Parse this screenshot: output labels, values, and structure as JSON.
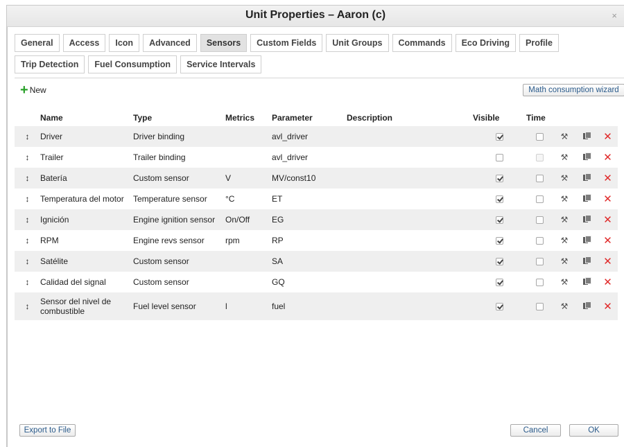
{
  "window": {
    "title": "Unit Properties – Aaron (c)",
    "close_glyph": "×"
  },
  "tabs_row1": [
    {
      "label": "General",
      "active": false
    },
    {
      "label": "Access",
      "active": false
    },
    {
      "label": "Icon",
      "active": false
    },
    {
      "label": "Advanced",
      "active": false
    },
    {
      "label": "Sensors",
      "active": true
    },
    {
      "label": "Custom Fields",
      "active": false
    },
    {
      "label": "Unit Groups",
      "active": false
    },
    {
      "label": "Commands",
      "active": false
    },
    {
      "label": "Eco Driving",
      "active": false
    },
    {
      "label": "Profile",
      "active": false
    }
  ],
  "tabs_row2": [
    {
      "label": "Trip Detection",
      "active": false
    },
    {
      "label": "Fuel Consumption",
      "active": false
    },
    {
      "label": "Service Intervals",
      "active": false
    }
  ],
  "toolbar": {
    "new_label": "New",
    "wizard_label": "Math consumption wizard"
  },
  "table": {
    "headers": {
      "name": "Name",
      "type": "Type",
      "metrics": "Metrics",
      "parameter": "Parameter",
      "description": "Description",
      "visible": "Visible",
      "time": "Time"
    },
    "rows": [
      {
        "name": "Driver",
        "type": "Driver binding",
        "metrics": "",
        "parameter": "avl_driver",
        "description": "",
        "visible": true,
        "time": false,
        "time_disabled": false
      },
      {
        "name": "Trailer",
        "type": "Trailer binding",
        "metrics": "",
        "parameter": "avl_driver",
        "description": "",
        "visible": false,
        "time": false,
        "time_disabled": true
      },
      {
        "name": "Batería",
        "type": "Custom sensor",
        "metrics": "V",
        "parameter": "MV/const10",
        "description": "",
        "visible": true,
        "time": false,
        "time_disabled": false
      },
      {
        "name": "Temperatura del motor",
        "type": "Temperature sensor",
        "metrics": "°C",
        "parameter": "ET",
        "description": "",
        "visible": true,
        "time": false,
        "time_disabled": false
      },
      {
        "name": "Ignición",
        "type": "Engine ignition sensor",
        "metrics": "On/Off",
        "parameter": "EG",
        "description": "",
        "visible": true,
        "time": false,
        "time_disabled": false
      },
      {
        "name": "RPM",
        "type": "Engine revs sensor",
        "metrics": "rpm",
        "parameter": "RP",
        "description": "",
        "visible": true,
        "time": false,
        "time_disabled": false
      },
      {
        "name": "Satélite",
        "type": "Custom sensor",
        "metrics": "",
        "parameter": "SA",
        "description": "",
        "visible": true,
        "time": false,
        "time_disabled": false
      },
      {
        "name": "Calidad del signal",
        "type": "Custom sensor",
        "metrics": "",
        "parameter": "GQ",
        "description": "",
        "visible": true,
        "time": false,
        "time_disabled": false
      },
      {
        "name": "Sensor del nivel de combustible",
        "type": "Fuel level sensor",
        "metrics": "l",
        "parameter": "fuel",
        "description": "",
        "visible": true,
        "time": false,
        "time_disabled": false
      }
    ]
  },
  "footer": {
    "export_label": "Export to File",
    "cancel_label": "Cancel",
    "ok_label": "OK"
  },
  "colors": {
    "accent_blue": "#1a7fd4",
    "delete_red": "#e02a2a",
    "new_green": "#2aa12a",
    "row_stripe": "#efefef"
  },
  "icons": {
    "row_drag": "drag-arrow-icon",
    "edit": "wrench-icon",
    "copy": "copy-icon",
    "delete": "delete-x-icon"
  }
}
